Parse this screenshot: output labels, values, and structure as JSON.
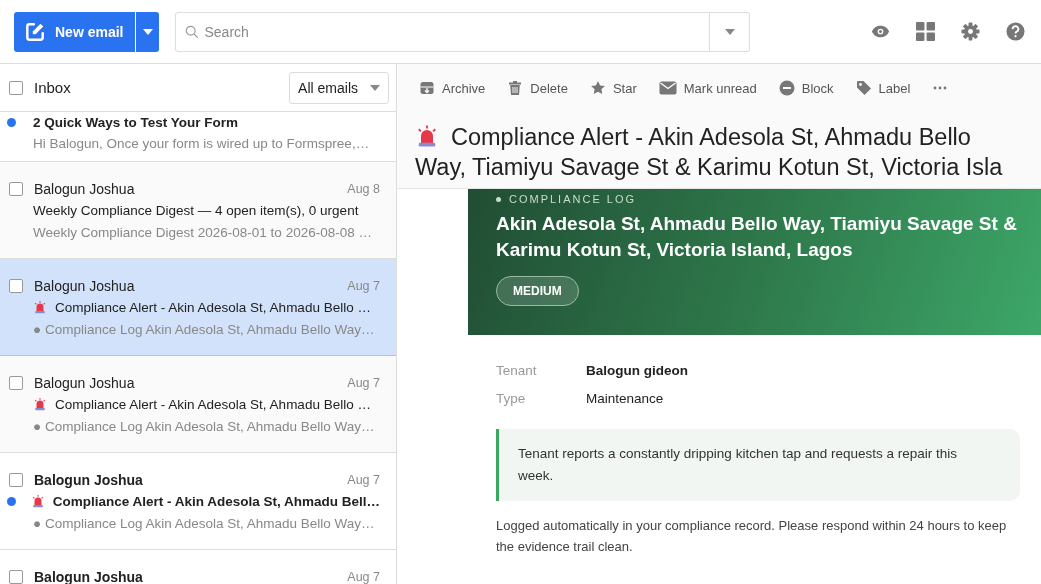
{
  "toolbar": {
    "compose": {
      "label": "New email"
    },
    "search": {
      "placeholder": "Search"
    }
  },
  "list": {
    "title": "Inbox",
    "select_all": {
      "checked": false
    },
    "filter": "All emails",
    "items": [
      {
        "kind": "plain",
        "subject": "2 Quick Ways to Test Your Form",
        "preview": "Hi Balogun, Once your form is wired up to Formspree,…",
        "unread": true,
        "selected": false
      },
      {
        "kind": "plain",
        "sender": "Balogun Joshua",
        "date": "Aug 8",
        "subject": "Weekly Compliance Digest — 4 open item(s), 0 urgent",
        "preview": "Weekly Compliance Digest 2026-08-01 to 2026-08-08 …",
        "unread": false,
        "selected": false,
        "checked": false
      },
      {
        "kind": "alert",
        "sender": "Balogun Joshua",
        "date": "Aug 7",
        "subject": "Compliance Alert - Akin Adesola St, Ahmadu Bello …",
        "preview": "● Compliance Log Akin Adesola St, Ahmadu Bello Way…",
        "unread": false,
        "selected": true,
        "checked": false
      },
      {
        "kind": "alert",
        "sender": "Balogun Joshua",
        "date": "Aug 7",
        "subject": "Compliance Alert - Akin Adesola St, Ahmadu Bello …",
        "preview": "● Compliance Log Akin Adesola St, Ahmadu Bello Way…",
        "unread": false,
        "selected": false,
        "checked": false
      },
      {
        "kind": "alert",
        "sender": "Balogun Joshua",
        "date": "Aug 7",
        "subject": "Compliance Alert - Akin Adesola St, Ahmadu Bell…",
        "preview": "● Compliance Log Akin Adesola St, Ahmadu Bello Way…",
        "unread": true,
        "selected": false,
        "checked": false
      },
      {
        "kind": "plain",
        "sender": "Balogun Joshua",
        "date": "Aug 7",
        "unread": true,
        "selected": false,
        "checked": false
      }
    ]
  },
  "reader": {
    "actions": [
      {
        "kind": "archive",
        "label": "Archive"
      },
      {
        "kind": "delete",
        "label": "Delete"
      },
      {
        "kind": "star",
        "label": "Star"
      },
      {
        "kind": "unread",
        "label": "Mark unread"
      },
      {
        "kind": "block",
        "label": "Block"
      },
      {
        "kind": "label",
        "label": "Label"
      },
      {
        "kind": "more"
      }
    ],
    "subject": "Compliance Alert - Akin Adesola St, Ahmadu Bello Way, Tiamiyu Savage St & Karimu Kotun St, Victoria Isla",
    "banner": {
      "eyebrow": "COMPLIANCE LOG",
      "heading": "Akin Adesola St, Ahmadu Bello Way, Tiamiyu Savage St & Karimu Kotun St, Victoria Island, Lagos",
      "severity": "MEDIUM"
    },
    "fields": [
      {
        "label": "Tenant",
        "value": "Balogun gideon",
        "bold": true
      },
      {
        "label": "Type",
        "value": "Maintenance",
        "bold": false
      }
    ],
    "note": "Tenant reports a constantly dripping kitchen tap and requests a repair this week.",
    "footer": "Logged automatically in your compliance record. Please respond within 24 hours to keep the evidence trail clean."
  }
}
